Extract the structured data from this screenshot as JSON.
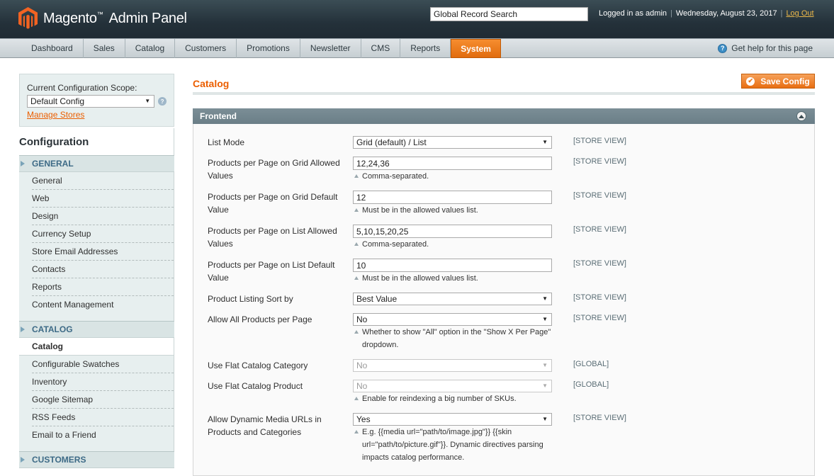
{
  "header": {
    "logo_brand": "Magento",
    "logo_tm": "™",
    "logo_suffix": "Admin Panel",
    "search_value": "Global Record Search",
    "logged_in": "Logged in as admin",
    "date": "Wednesday, August 23, 2017",
    "logout": "Log Out",
    "separator": "|"
  },
  "nav": {
    "items": [
      "Dashboard",
      "Sales",
      "Catalog",
      "Customers",
      "Promotions",
      "Newsletter",
      "CMS",
      "Reports",
      "System"
    ],
    "help": "Get help for this page"
  },
  "scope": {
    "label": "Current Configuration Scope:",
    "value": "Default Config",
    "manage": "Manage Stores"
  },
  "sidebar": {
    "title": "Configuration",
    "sections": [
      {
        "label": "GENERAL",
        "items": [
          "General",
          "Web",
          "Design",
          "Currency Setup",
          "Store Email Addresses",
          "Contacts",
          "Reports",
          "Content Management"
        ]
      },
      {
        "label": "CATALOG",
        "items": [
          "Catalog",
          "Configurable Swatches",
          "Inventory",
          "Google Sitemap",
          "RSS Feeds",
          "Email to a Friend"
        ]
      },
      {
        "label": "CUSTOMERS",
        "items": []
      }
    ]
  },
  "main": {
    "title": "Catalog",
    "save": "Save Config",
    "fieldset": "Frontend",
    "rows": [
      {
        "label": "List Mode",
        "value": "Grid (default) / List",
        "scope": "[STORE VIEW]",
        "note": ""
      },
      {
        "label": "Products per Page on Grid Allowed Values",
        "value": "12,24,36",
        "scope": "[STORE VIEW]",
        "note": "Comma-separated."
      },
      {
        "label": "Products per Page on Grid Default Value",
        "value": "12",
        "scope": "[STORE VIEW]",
        "note": "Must be in the allowed values list."
      },
      {
        "label": "Products per Page on List Allowed Values",
        "value": "5,10,15,20,25",
        "scope": "[STORE VIEW]",
        "note": "Comma-separated."
      },
      {
        "label": "Products per Page on List Default Value",
        "value": "10",
        "scope": "[STORE VIEW]",
        "note": "Must be in the allowed values list."
      },
      {
        "label": "Product Listing Sort by",
        "value": "Best Value",
        "scope": "[STORE VIEW]",
        "note": ""
      },
      {
        "label": "Allow All Products per Page",
        "value": "No",
        "scope": "[STORE VIEW]",
        "note": "Whether to show \"All\" option in the \"Show X Per Page\" dropdown."
      },
      {
        "label": "Use Flat Catalog Category",
        "value": "No",
        "scope": "[GLOBAL]",
        "note": ""
      },
      {
        "label": "Use Flat Catalog Product",
        "value": "No",
        "scope": "[GLOBAL]",
        "note": "Enable for reindexing a big number of SKUs."
      },
      {
        "label": "Allow Dynamic Media URLs in Products and Categories",
        "value": "Yes",
        "scope": "[STORE VIEW]",
        "note": "E.g. {{media url=\"path/to/image.jpg\"}} {{skin url=\"path/to/picture.gif\"}}. Dynamic directives parsing impacts catalog performance."
      }
    ]
  },
  "colors": {
    "accent": "#eb5e00",
    "header_bg": "#24313a",
    "active_tab": "#f08424"
  }
}
